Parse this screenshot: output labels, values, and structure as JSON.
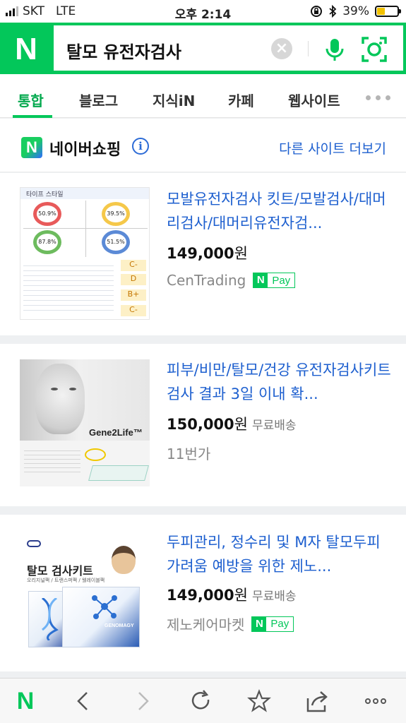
{
  "status": {
    "carrier": "SKT",
    "network": "LTE",
    "time": "오후 2:14",
    "battery_text": "39%",
    "battery_level": 0.39
  },
  "search": {
    "logo": "N",
    "query": "탈모 유전자검사",
    "clear_symbol": "×"
  },
  "tabs": [
    {
      "label": "통합",
      "active": true
    },
    {
      "label": "블로그",
      "active": false
    },
    {
      "label": "지식iN",
      "active": false
    },
    {
      "label": "카페",
      "active": false
    },
    {
      "label": "웹사이트",
      "active": false
    }
  ],
  "shopping": {
    "logo": "N",
    "title": "네이버쇼핑",
    "info_symbol": "i",
    "more_sites": "다른 사이트 더보기"
  },
  "products": [
    {
      "title": "모발유전자검사 킷트/모발검사/대머리검사/대머리유전자검...",
      "price": "149,000",
      "currency": "원",
      "shipping": "",
      "seller": "CenTrading",
      "npay": true,
      "thumb": {
        "heading": "타이프 스타일",
        "pct": [
          "50.9%",
          "39.5%",
          "87.8%",
          "51.5%"
        ],
        "grades": [
          "C-",
          "D",
          "B+",
          "C-"
        ]
      }
    },
    {
      "title": "피부/비만/탈모/건강 유전자검사키트 검사 결과 3일 이내 확...",
      "price": "150,000",
      "currency": "원",
      "shipping": "무료배송",
      "seller": "11번가",
      "npay": false,
      "thumb": {
        "brand": "Gene2Life™"
      }
    },
    {
      "title": "두피관리, 정수리 및 M자 탈모두피 가려움 예방을 위한 제노...",
      "price": "149,000",
      "currency": "원",
      "shipping": "무료배송",
      "seller": "제노케어마켓",
      "npay": true,
      "thumb": {
        "heading": "탈모 검사키트",
        "sub": "오리지널팩 / 트랜스퍼팩 / 웰레이블팩",
        "brand": "GENOMAGY"
      }
    }
  ],
  "npay_label": "Pay",
  "npay_logo": "N",
  "toolbar": {
    "home_logo": "N"
  }
}
